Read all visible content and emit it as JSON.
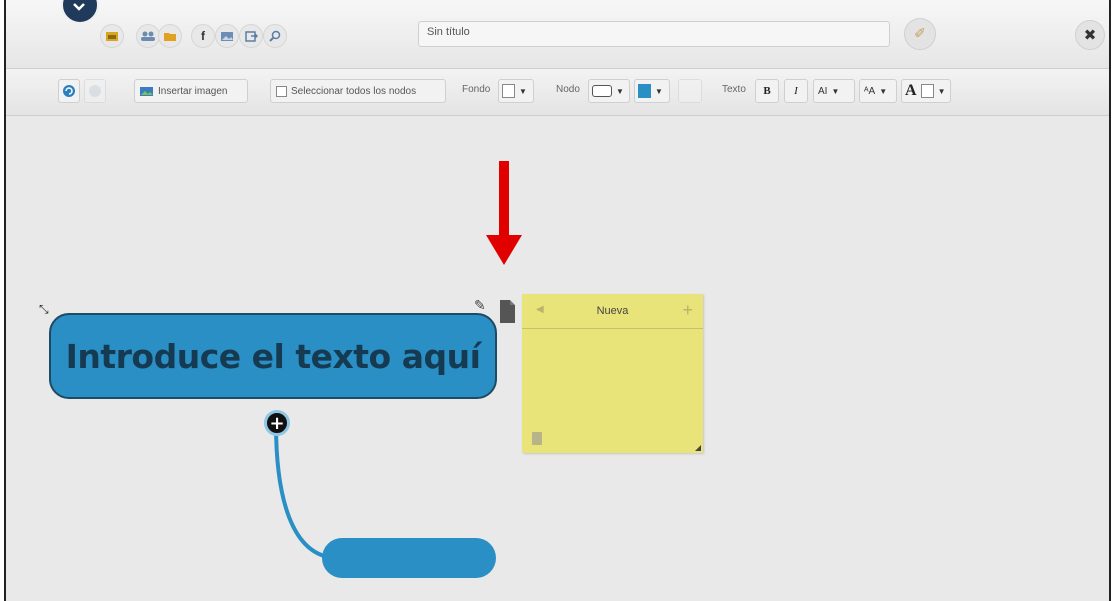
{
  "header": {
    "title_value": "Sin título",
    "toolbar_icons": [
      "image-icon",
      "people-icon",
      "folder-icon",
      "facebook-icon",
      "picture-icon",
      "export-icon",
      "search-icon"
    ]
  },
  "toolbar": {
    "insert_image": "Insertar imagen",
    "select_all": "Seleccionar todos los nodos",
    "fondo_label": "Fondo",
    "nodo_label": "Nodo",
    "texto_label": "Texto",
    "bold": "B",
    "italic": "I",
    "font_size": "AI",
    "font_case": "ᴬA",
    "font_color": "A",
    "node_color": "#2a8fc4"
  },
  "canvas": {
    "main_node_text": "Introduce el texto aquí",
    "sticky_note": {
      "title": "Nueva"
    },
    "colors": {
      "node": "#2a8fc4",
      "sticky": "#e9e47a",
      "arrow": "#e00000"
    }
  }
}
